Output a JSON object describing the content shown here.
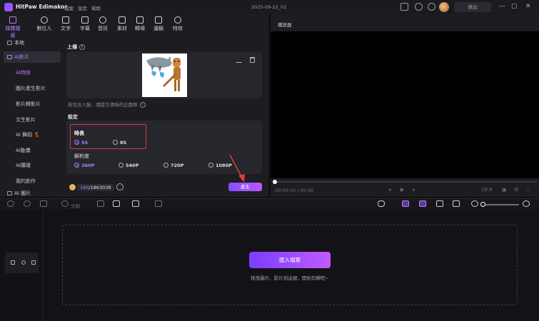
{
  "app": {
    "name": "HitPaw Edimakor",
    "menu": [
      "檔案",
      "設定",
      "幫助"
    ],
    "version": "2025-09-22_01",
    "export_label": "匯出"
  },
  "toolbar": {
    "tabs": [
      {
        "label": "媒體檔案",
        "icon": "media-icon"
      },
      {
        "label": "數位人",
        "icon": "avatar-icon"
      },
      {
        "label": "文字",
        "icon": "text-icon"
      },
      {
        "label": "字幕",
        "icon": "subtitle-icon"
      },
      {
        "label": "音訊",
        "icon": "audio-icon"
      },
      {
        "label": "素材",
        "icon": "elements-icon"
      },
      {
        "label": "轉場",
        "icon": "transition-icon"
      },
      {
        "label": "濾鏡",
        "icon": "filter-icon"
      },
      {
        "label": "特效",
        "icon": "effects-icon"
      }
    ]
  },
  "sidebar": {
    "local": "本地",
    "ai_video": "AI影片",
    "items": [
      "AI特效",
      "圖片產生影片",
      "影片轉影片",
      "文生影片",
      "AI 舞蹈 💃",
      "AI動畫",
      "AI購環",
      "我的創作"
    ],
    "ai_image": "AI 圖片"
  },
  "panel": {
    "upload_label": "上傳",
    "upload_hint": "若包含人臉，請提交清晰的正面照",
    "settings_label": "設定",
    "duration_label": "時長",
    "durations": [
      "5S",
      "8S"
    ],
    "duration_selected": "5S",
    "resolution_label": "解析度",
    "resolutions": [
      "360P",
      "540P",
      "720P",
      "1080P"
    ],
    "resolution_selected": "360P",
    "credits_used": "160",
    "credits_total": "/1863038",
    "generate_label": "產生"
  },
  "player": {
    "title": "播放器",
    "time": "00:00:00 / 00:00",
    "aspect": "16:9"
  },
  "edit_toolbar": {
    "split_label": "分割"
  },
  "timeline": {
    "import_label": "匯入檔案",
    "drop_hint": "拖曳圖片、影片到這裡，開始剪輯吧~"
  },
  "colors": {
    "accent": "#b77dff",
    "highlight_box": "#e03a3a",
    "generate_button": "#9a50ff"
  }
}
